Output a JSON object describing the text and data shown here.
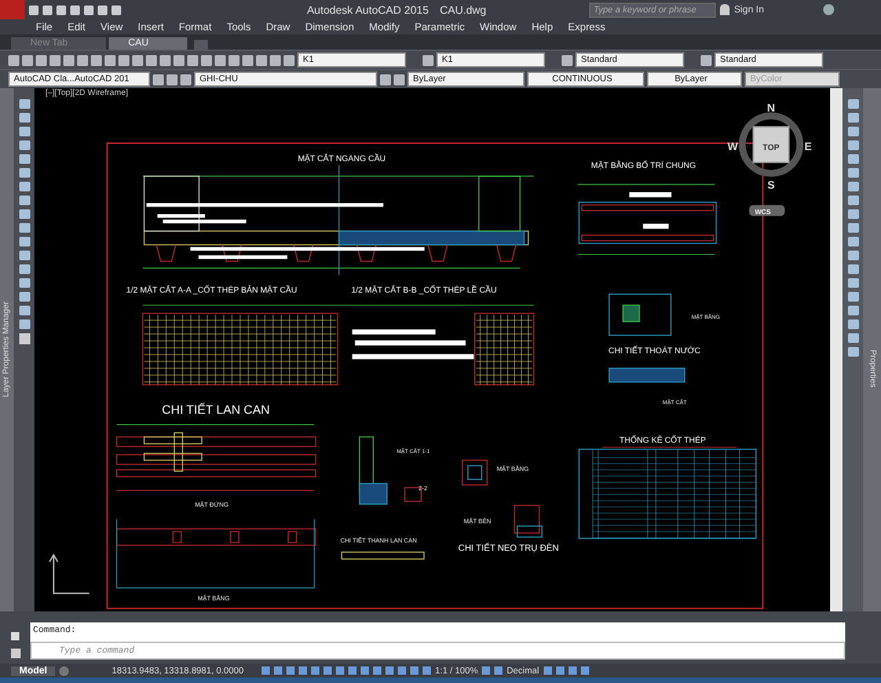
{
  "title_bar": {
    "title": "Autodesk AutoCAD 2015",
    "file": "CAU.dwg",
    "search": {
      "placeholder": "Type a keyword or phrase"
    },
    "sign_in": "Sign In"
  },
  "menu": [
    "File",
    "Edit",
    "View",
    "Insert",
    "Format",
    "Tools",
    "Draw",
    "Dimension",
    "Modify",
    "Parametric",
    "Window",
    "Help",
    "Express"
  ],
  "tabs": [
    {
      "label": "New Tab",
      "selected": false
    },
    {
      "label": "CAU",
      "selected": true
    }
  ],
  "toolbar_1": {
    "dropdowns": [
      "K1",
      "K1",
      "Standard",
      "Standard"
    ]
  },
  "toolbar_2": {
    "workspace": "AutoCAD Cla...AutoCAD 201",
    "layer": "GHI-CHU",
    "color_control": "ByLayer",
    "linetype": "CONTINUOUS",
    "lineweight": "ByLayer",
    "plot_style": "ByColor"
  },
  "left_palette": {
    "title": "Layer Properties Manager"
  },
  "viewport": {
    "label": "[–][Top][2D Wireframe]",
    "viewcube": {
      "north": "N",
      "west": "W",
      "east": "E",
      "south": "S",
      "face": "TOP",
      "ucs": "WCS"
    },
    "drawing_labels": [
      {
        "text": "MẶT CẮT NGANG  CẦU",
        "kind": "title"
      },
      {
        "text": "MẶT BẰNG BỐ TRÍ CHUNG",
        "kind": "title"
      },
      {
        "text": "1/2 MẶT CẮT A-A _CỐT THÉP BẢN MẶT CẦU",
        "kind": "title"
      },
      {
        "text": "1/2 MẶT CẮT B-B _CỐT THÉP LỀ  CẦU",
        "kind": "title"
      },
      {
        "text": "MẶT BẰNG",
        "kind": "caption"
      },
      {
        "text": "CHI TIẾT THOÁT NƯỚC",
        "kind": "title"
      },
      {
        "text": "MẶT CẮT",
        "kind": "caption"
      },
      {
        "text": "CHI TIẾT  LAN CAN",
        "kind": "heading"
      },
      {
        "text": "THỐNG KÊ CỐT THÉP",
        "kind": "title"
      },
      {
        "text": "MẶT CẮT 1-1",
        "kind": "caption"
      },
      {
        "text": "MẶT BẰNG",
        "kind": "caption"
      },
      {
        "text": "2-2",
        "kind": "caption"
      },
      {
        "text": "MẶT ĐỨNG",
        "kind": "caption"
      },
      {
        "text": "MẶT BÊN",
        "kind": "caption"
      },
      {
        "text": "CHI TIẾT THANH LAN CAN",
        "kind": "caption"
      },
      {
        "text": "CHI TIẾT NEO TRỤ ĐÈN",
        "kind": "heading"
      },
      {
        "text": "MẶT BẰNG",
        "kind": "caption"
      }
    ]
  },
  "right_palette": {
    "title": "Properties"
  },
  "command_line": {
    "history": "Command:",
    "placeholder": "Type a command"
  },
  "status_bar": {
    "tab": "Model",
    "coordinates": "18313.9483, 13318.8981, 0.0000",
    "scale": "1:1 / 100%",
    "units": "Decimal"
  }
}
